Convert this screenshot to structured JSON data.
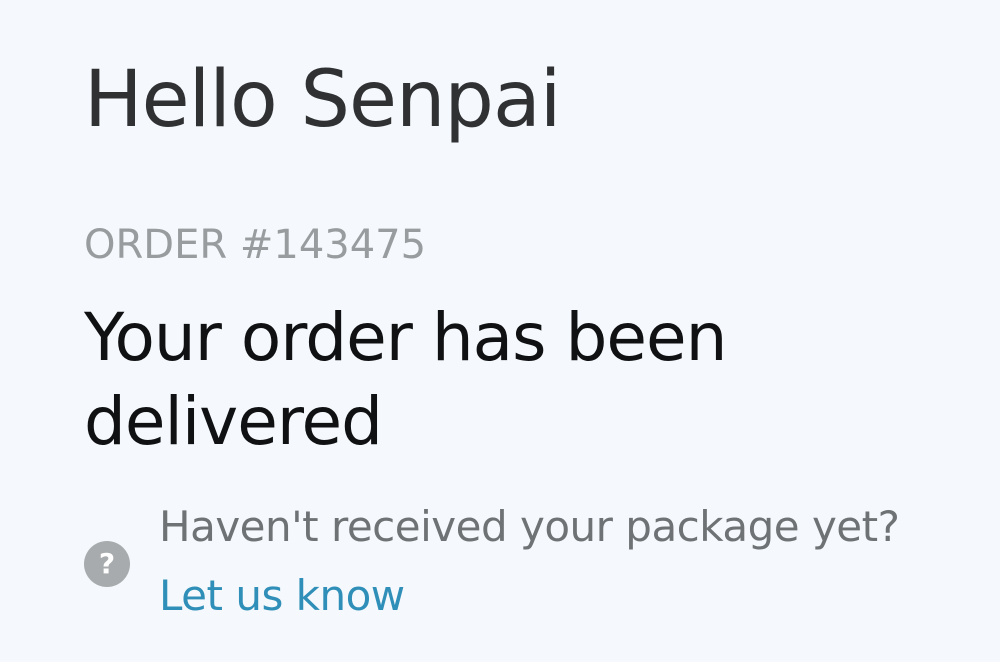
{
  "greeting": "Hello Senpai",
  "order": {
    "number_label": "ORDER #143475",
    "status": "Your order has been delivered"
  },
  "help": {
    "icon": "question-icon",
    "icon_glyph": "?",
    "question": "Haven't received your package yet?",
    "link_label": "Let us know"
  },
  "colors": {
    "background": "#f5f8fc",
    "link": "#2f8fb8",
    "muted": "#999c9e"
  }
}
